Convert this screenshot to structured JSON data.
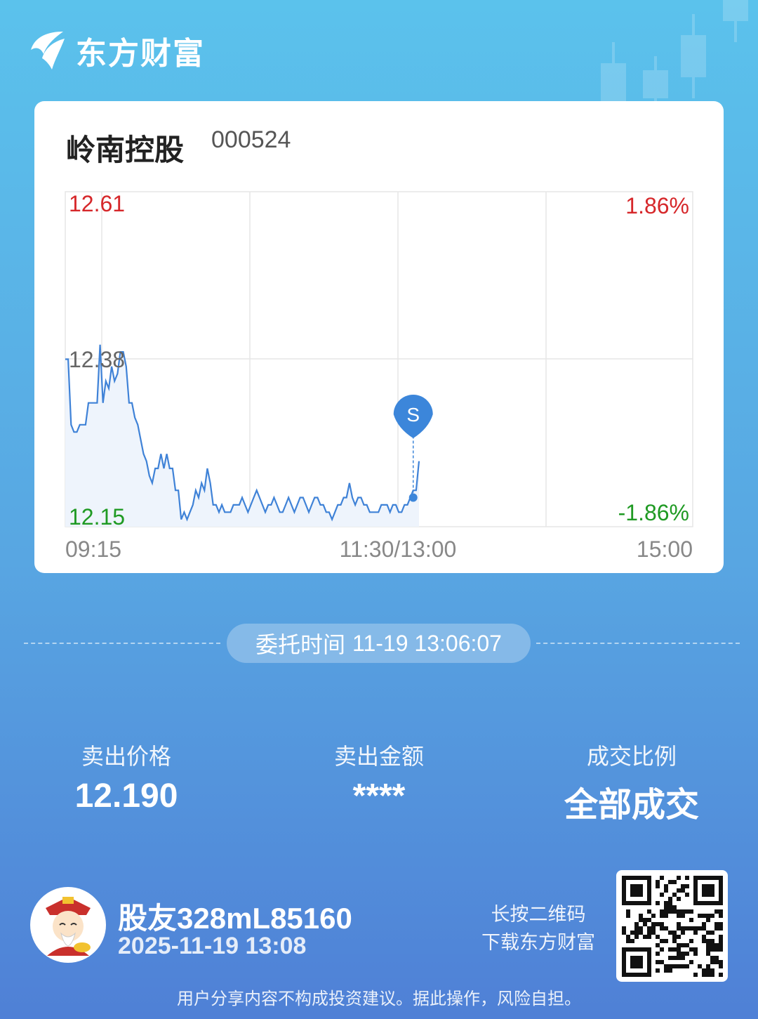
{
  "brand": {
    "name": "东方财富"
  },
  "stock": {
    "name": "岭南控股",
    "code": "000524"
  },
  "chart_data": {
    "type": "line",
    "y_labels": {
      "high": "12.61",
      "mid": "12.38",
      "low": "12.15"
    },
    "pct_labels": {
      "high": "1.86%",
      "low": "-1.86%"
    },
    "x_labels": [
      "09:15",
      "11:30/13:00",
      "15:00"
    ],
    "ylim": [
      12.15,
      12.61
    ],
    "prev_close": 12.38,
    "marker": {
      "label": "S",
      "price": 12.19
    },
    "series": [
      {
        "values": [
          12.38,
          12.38,
          12.29,
          12.28,
          12.28,
          12.29,
          12.29,
          12.29,
          12.32,
          12.32,
          12.32,
          12.32,
          12.4,
          12.32,
          12.35,
          12.34,
          12.37,
          12.35,
          12.36,
          12.39,
          12.39,
          12.37,
          12.32,
          12.32,
          12.3,
          12.29,
          12.27,
          12.25,
          12.24,
          12.22,
          12.21,
          12.23,
          12.23,
          12.25,
          12.23,
          12.25,
          12.23,
          12.23,
          12.2,
          12.2,
          12.16,
          12.17,
          12.16,
          12.17,
          12.18,
          12.2,
          12.19,
          12.21,
          12.2,
          12.23,
          12.21,
          12.18,
          12.18,
          12.17,
          12.18,
          12.17,
          12.17,
          12.17,
          12.18,
          12.18,
          12.18,
          12.19,
          12.18,
          12.17,
          12.18,
          12.19,
          12.2,
          12.19,
          12.18,
          12.17,
          12.18,
          12.18,
          12.19,
          12.18,
          12.17,
          12.17,
          12.18,
          12.19,
          12.18,
          12.17,
          12.18,
          12.19,
          12.19,
          12.18,
          12.17,
          12.18,
          12.19,
          12.19,
          12.18,
          12.18,
          12.17,
          12.17,
          12.16,
          12.17,
          12.18,
          12.18,
          12.19,
          12.19,
          12.21,
          12.19,
          12.18,
          12.19,
          12.19,
          12.18,
          12.18,
          12.17,
          12.17,
          12.17,
          12.17,
          12.18,
          12.18,
          12.18,
          12.17,
          12.18,
          12.18,
          12.17,
          12.17,
          12.18,
          12.18,
          12.19,
          12.2,
          12.2,
          12.24
        ]
      }
    ]
  },
  "order": {
    "label": "委托时间",
    "time": "11-19 13:06:07"
  },
  "stats": [
    {
      "label": "卖出价格",
      "value": "12.190"
    },
    {
      "label": "卖出金额",
      "value": "****"
    },
    {
      "label": "成交比例",
      "value": "全部成交"
    }
  ],
  "user": {
    "name": "股友328mL85160",
    "time": "2025-11-19 13:08"
  },
  "qr_tip": [
    "长按二维码",
    "下载东方财富"
  ],
  "disclaimer": "用户分享内容不构成投资建议。据此操作，风险自担。",
  "colors": {
    "up": "#d6272a",
    "down": "#1f9a23",
    "line": "#3f82d7",
    "marker": "#3c86da"
  }
}
